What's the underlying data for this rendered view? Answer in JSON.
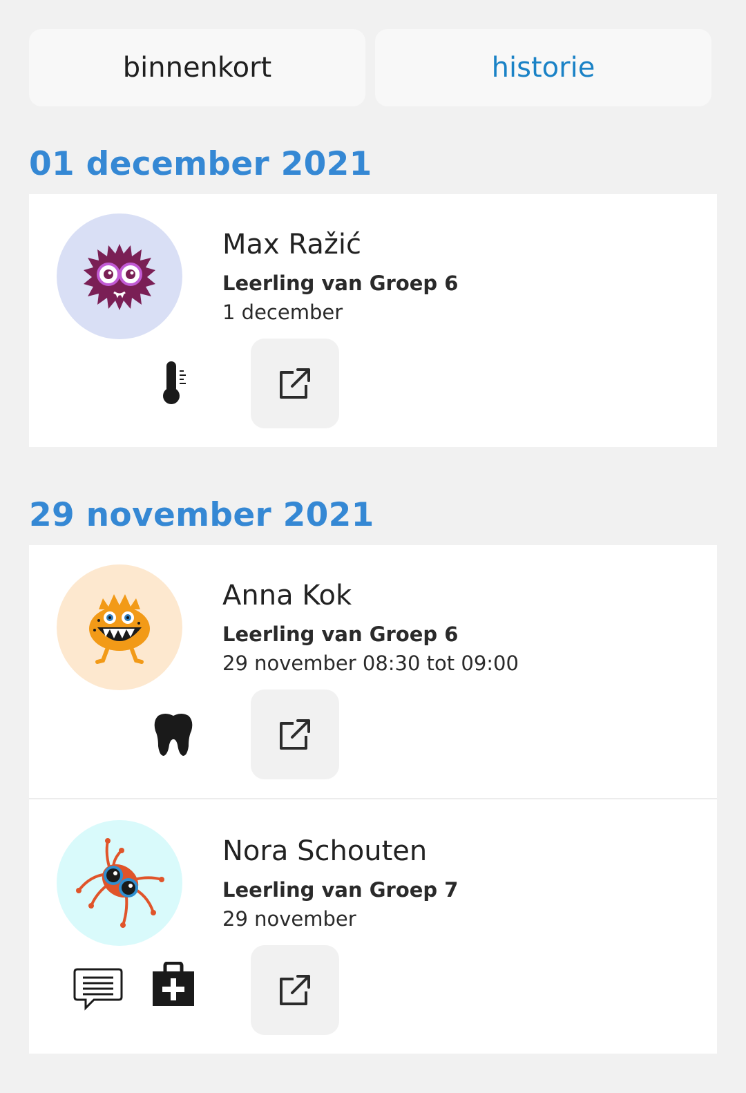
{
  "tabs": {
    "upcoming_label": "binnenkort",
    "history_label": "historie"
  },
  "sections": [
    {
      "date": "01 december 2021",
      "entries": [
        {
          "name": "Max Ražić",
          "group": "Leerling van Groep 6",
          "when": "1 december",
          "avatar_bg": "#d9dff5",
          "icons": [
            "thermometer-icon"
          ]
        }
      ]
    },
    {
      "date": "29 november 2021",
      "entries": [
        {
          "name": "Anna Kok",
          "group": "Leerling van Groep 6",
          "when": "29 november 08:30 tot 09:00",
          "avatar_bg": "#fde8cf",
          "icons": [
            "tooth-icon"
          ]
        },
        {
          "name": "Nora Schouten",
          "group": "Leerling van Groep 7",
          "when": "29 november",
          "avatar_bg": "#d9fafb",
          "icons": [
            "comment-icon",
            "medical-bag-icon"
          ]
        }
      ]
    }
  ],
  "colors": {
    "accent": "#3588d4",
    "active_tab": "#1a82c6",
    "background": "#f1f1f1",
    "card": "#ffffff"
  }
}
